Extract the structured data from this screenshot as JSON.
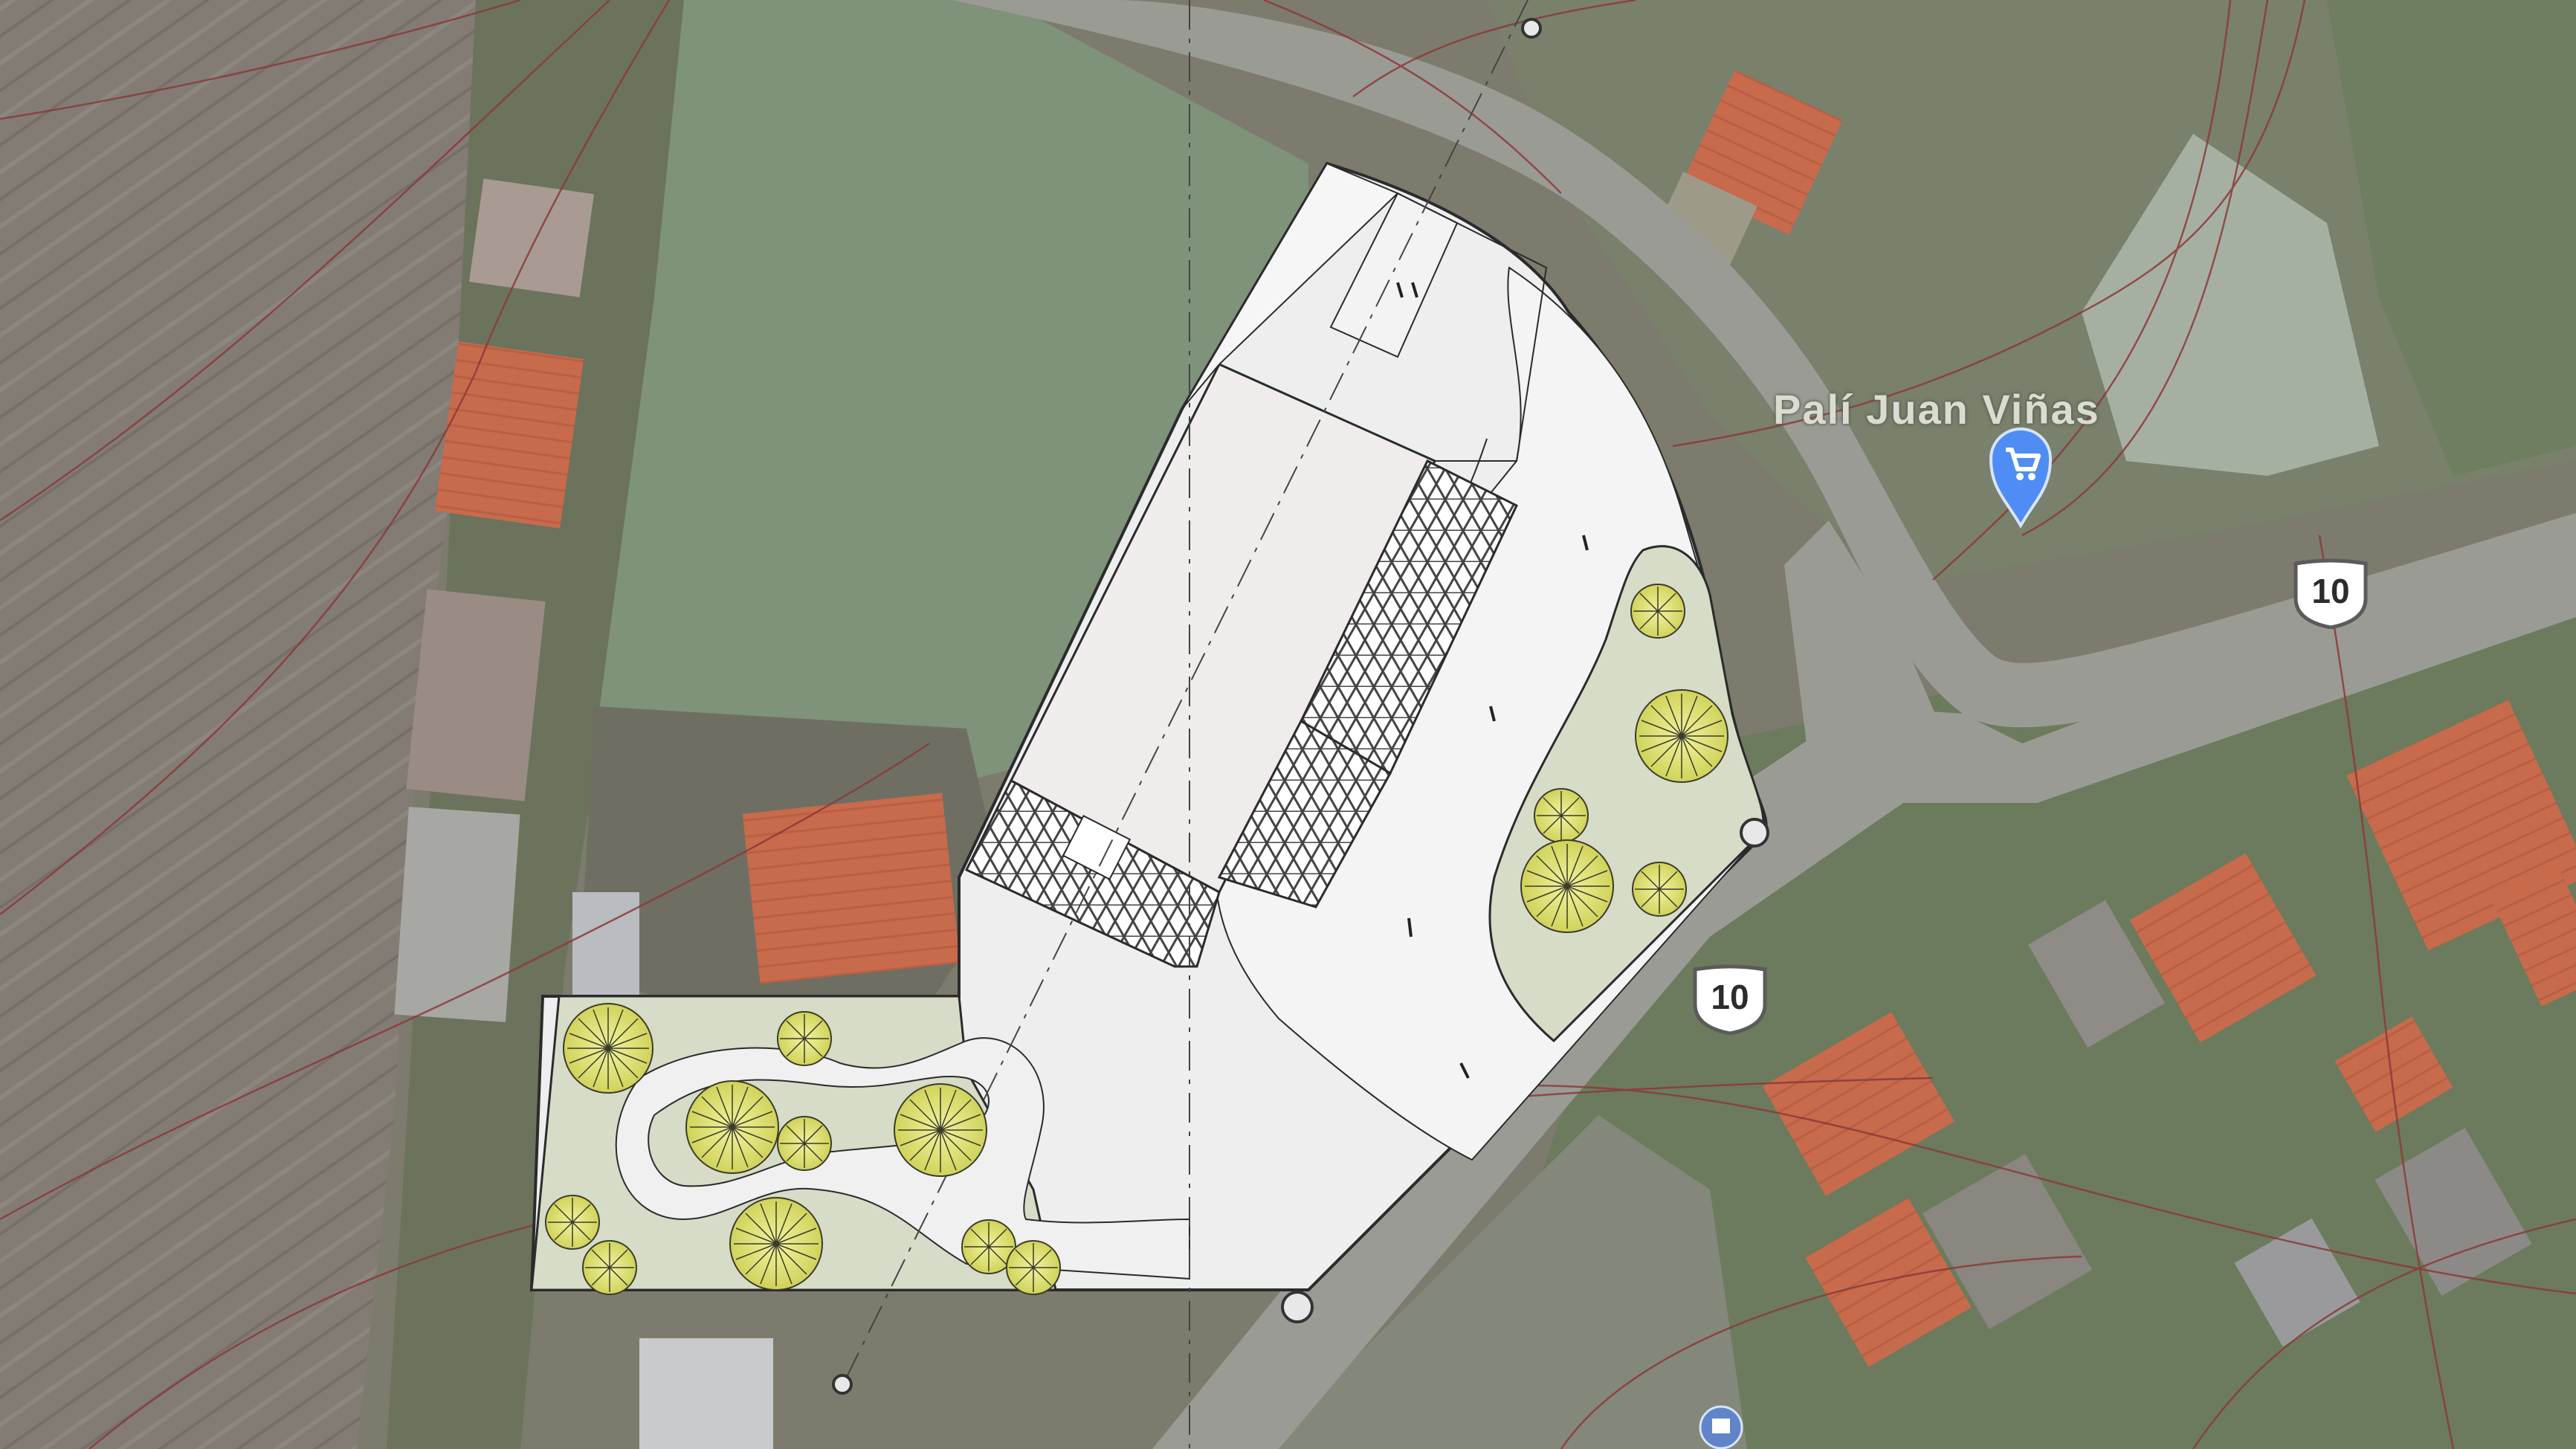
{
  "map": {
    "poi": {
      "label": "Palí Juan Viñas",
      "icon": "shopping-cart-pin-icon",
      "pin_color": "#4f8df5"
    },
    "route_shields": [
      {
        "label": "10"
      },
      {
        "label": "10"
      }
    ],
    "colors": {
      "site_outline": "#2b2b2b",
      "paving": "#eeeeee",
      "building_roof": "#efeceb",
      "planting": "#d6dcc8",
      "tree_canopy": "#e6ea78",
      "contour_lines": "#8b3a3a",
      "roof_tiles": "#c86a4c"
    }
  }
}
